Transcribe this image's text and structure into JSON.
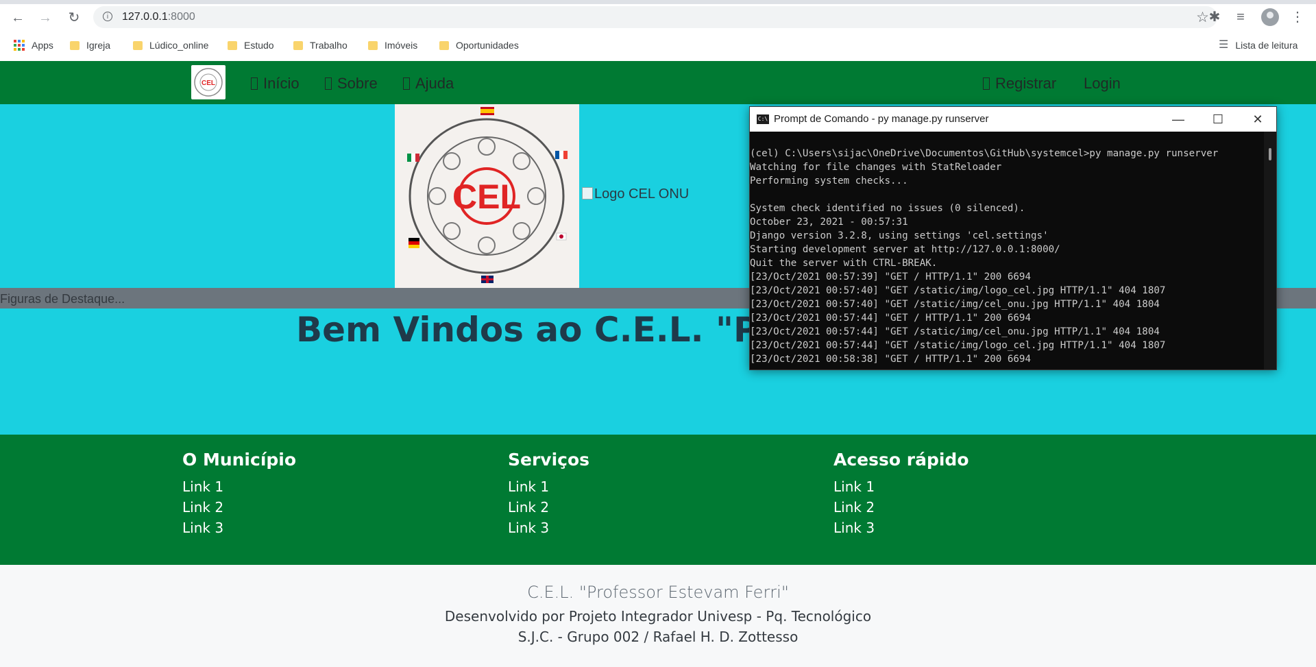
{
  "browser": {
    "url_host": "127.0.0.1",
    "url_port": ":8000",
    "bookmarks": [
      "Apps",
      "Igreja",
      "Lúdico_online",
      "Estudo",
      "Trabalho",
      "Imóveis",
      "Oportunidades"
    ],
    "reading_list": "Lista de leitura"
  },
  "site": {
    "nav": {
      "inicio": "Início",
      "sobre": "Sobre",
      "ajuda": "Ajuda",
      "registrar": "Registrar",
      "login": "Login"
    },
    "broken_image_alt": "Logo CEL ONU",
    "featured": "Figuras de Destaque...",
    "welcome": "Bem Vindos ao C.E.L. \"Profess",
    "footer": {
      "col1": {
        "title": "O Município",
        "links": [
          "Link 1",
          "Link 2",
          "Link 3"
        ]
      },
      "col2": {
        "title": "Serviços",
        "links": [
          "Link 1",
          "Link 2",
          "Link 3"
        ]
      },
      "col3": {
        "title": "Acesso rápido",
        "links": [
          "Link 1",
          "Link 2",
          "Link 3"
        ]
      }
    },
    "credits": {
      "line1": "C.E.L. \"Professor Estevam Ferri\"",
      "line2": "Desenvolvido por Projeto Integrador Univesp - Pq. Tecnológico",
      "line3": "S.J.C. - Grupo 002 / Rafael H. D. Zottesso"
    }
  },
  "console": {
    "title": "Prompt de Comando - py  manage.py runserver",
    "icon_label": "C:\\",
    "lines": [
      "(cel) C:\\Users\\sijac\\OneDrive\\Documentos\\GitHub\\systemcel>py manage.py runserver",
      "Watching for file changes with StatReloader",
      "Performing system checks...",
      "",
      "System check identified no issues (0 silenced).",
      "October 23, 2021 - 00:57:31",
      "Django version 3.2.8, using settings 'cel.settings'",
      "Starting development server at http://127.0.0.1:8000/",
      "Quit the server with CTRL-BREAK.",
      "[23/Oct/2021 00:57:39] \"GET / HTTP/1.1\" 200 6694",
      "[23/Oct/2021 00:57:40] \"GET /static/img/logo_cel.jpg HTTP/1.1\" 404 1807",
      "[23/Oct/2021 00:57:40] \"GET /static/img/cel_onu.jpg HTTP/1.1\" 404 1804",
      "[23/Oct/2021 00:57:44] \"GET / HTTP/1.1\" 200 6694",
      "[23/Oct/2021 00:57:44] \"GET /static/img/cel_onu.jpg HTTP/1.1\" 404 1804",
      "[23/Oct/2021 00:57:44] \"GET /static/img/logo_cel.jpg HTTP/1.1\" 404 1807",
      "[23/Oct/2021 00:58:38] \"GET / HTTP/1.1\" 200 6694"
    ]
  },
  "colors": {
    "nav_green": "#007a33",
    "hero_cyan": "#1ad0e0",
    "featured_gray": "#6c757d",
    "cel_red": "#e02424"
  }
}
